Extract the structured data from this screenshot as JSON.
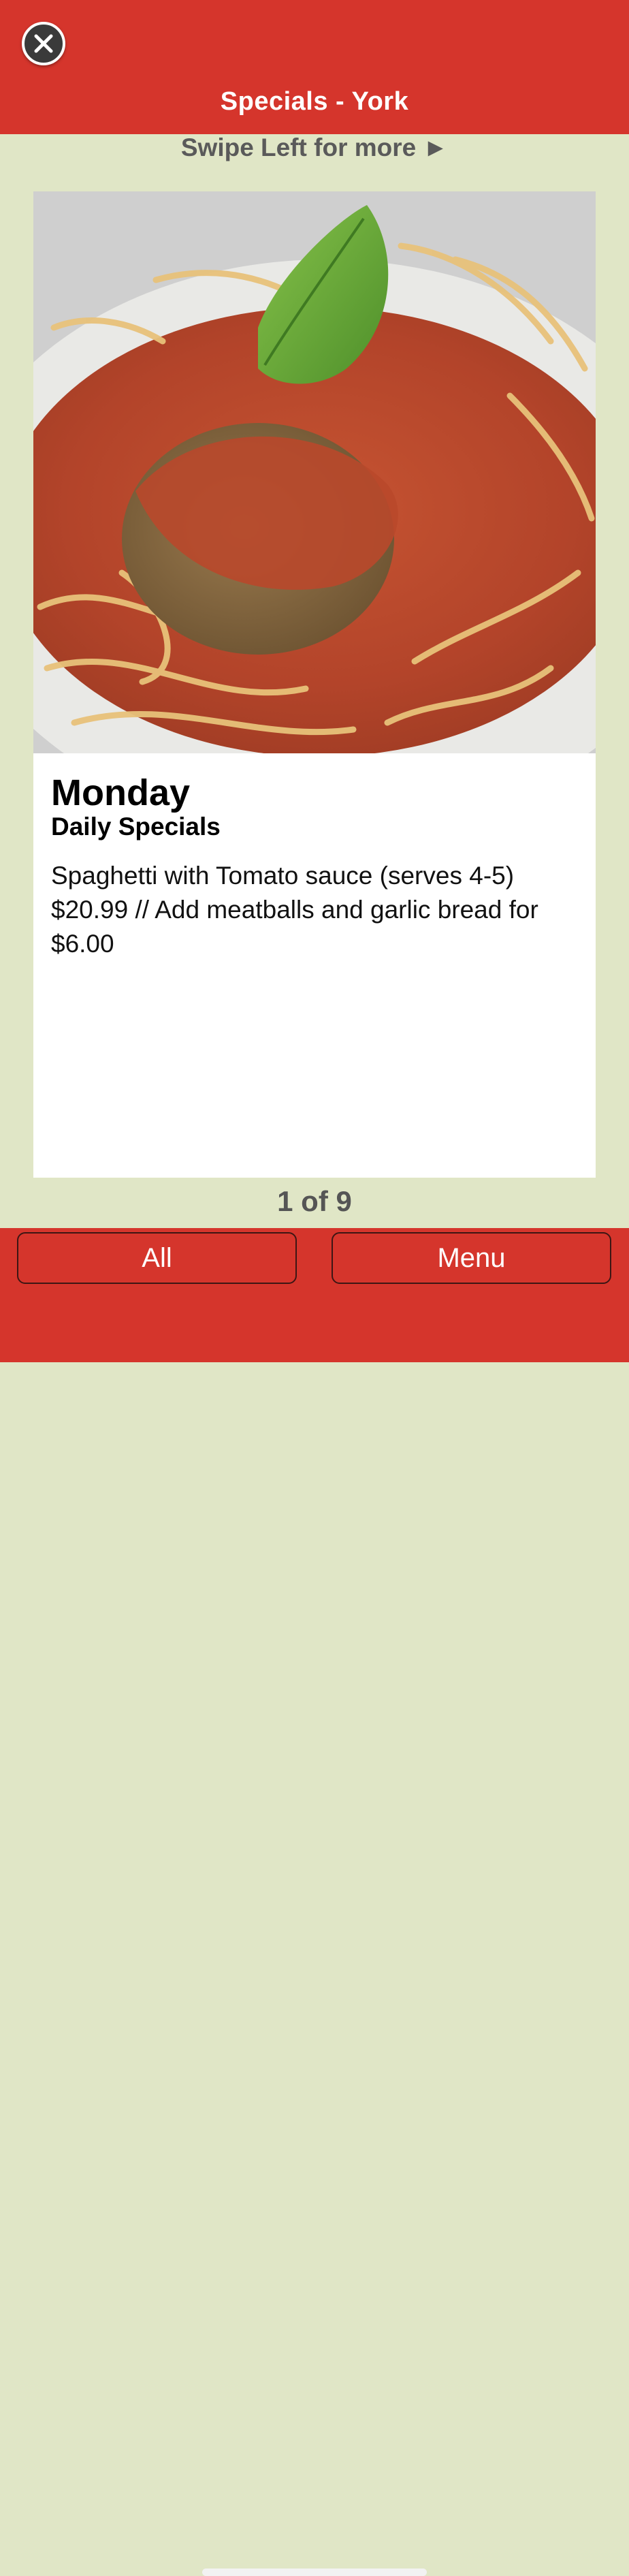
{
  "header": {
    "title": "Specials - York",
    "close_icon": "close-circle-icon"
  },
  "swipe_hint": "Swipe Left for more ►",
  "card": {
    "image_description": "spaghetti-meatball-photo",
    "title": "Monday",
    "subtitle": "Daily Specials",
    "description": "Spaghetti with Tomato sauce (serves 4-5) $20.99 // Add meatballs and garlic bread for $6.00"
  },
  "pager": {
    "text": "1 of 9",
    "current": 1,
    "total": 9
  },
  "footer": {
    "all_label": "All",
    "menu_label": "Menu"
  },
  "colors": {
    "brand_red": "#d5352c",
    "background": "#e0e6c6",
    "card_bg": "#ffffff"
  }
}
